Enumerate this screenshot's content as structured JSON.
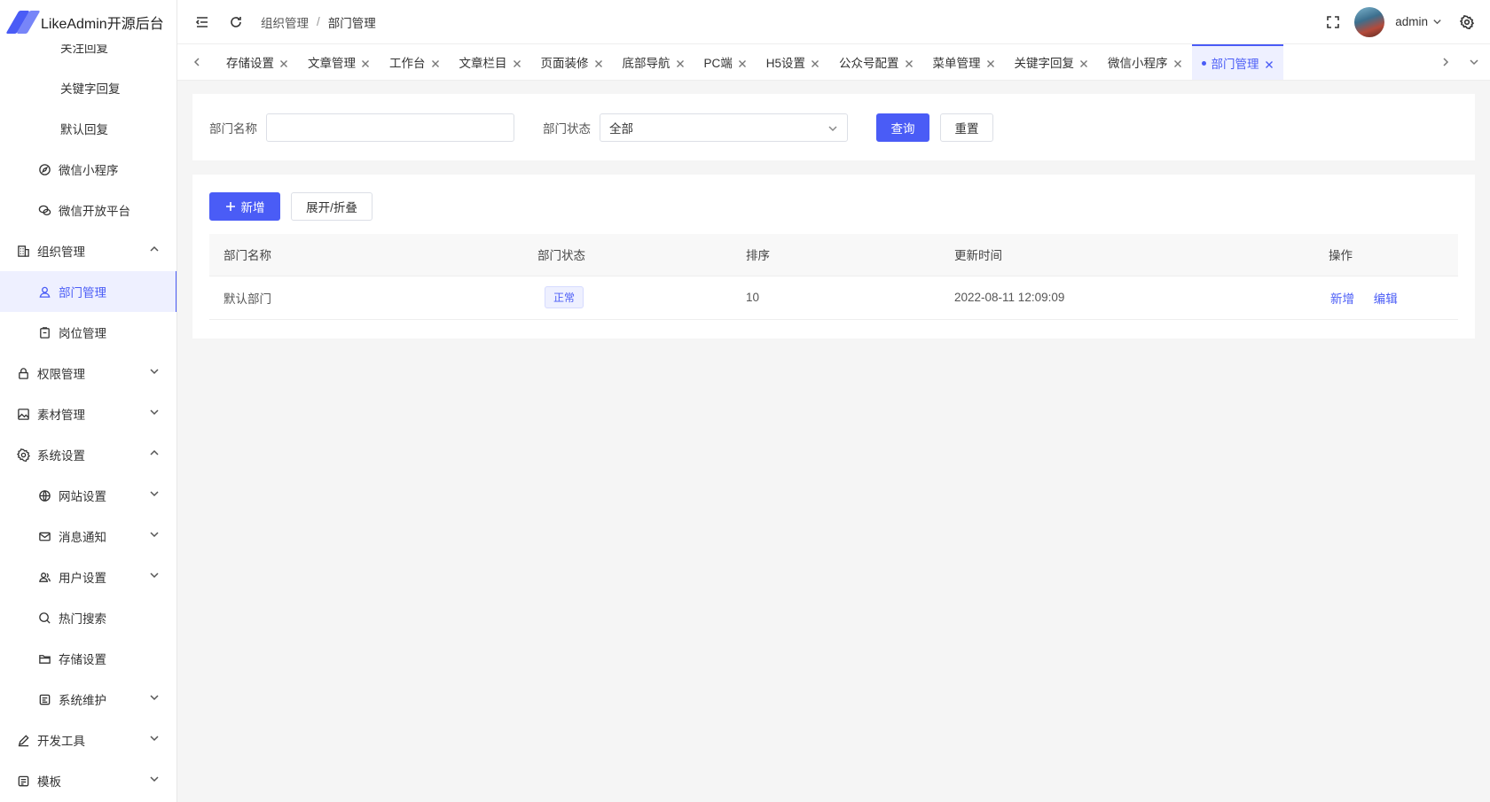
{
  "app": {
    "title": "LikeAdmin开源后台"
  },
  "sidebar": {
    "items": [
      {
        "label": "关注回复",
        "level": 3
      },
      {
        "label": "关键字回复",
        "level": 3
      },
      {
        "label": "默认回复",
        "level": 3
      },
      {
        "label": "微信小程序",
        "level": 2,
        "icon": "compass-icon"
      },
      {
        "label": "微信开放平台",
        "level": 2,
        "icon": "wechat-icon"
      },
      {
        "label": "组织管理",
        "level": 1,
        "icon": "building-icon",
        "arrow": "up"
      },
      {
        "label": "部门管理",
        "level": 2,
        "icon": "user-icon",
        "active": true
      },
      {
        "label": "岗位管理",
        "level": 2,
        "icon": "clipboard-icon"
      },
      {
        "label": "权限管理",
        "level": 1,
        "icon": "lock-icon",
        "arrow": "down"
      },
      {
        "label": "素材管理",
        "level": 1,
        "icon": "picture-icon",
        "arrow": "down"
      },
      {
        "label": "系统设置",
        "level": 1,
        "icon": "gear-icon",
        "arrow": "up"
      },
      {
        "label": "网站设置",
        "level": 2,
        "icon": "globe-icon",
        "arrow": "down"
      },
      {
        "label": "消息通知",
        "level": 2,
        "icon": "mail-icon",
        "arrow": "down"
      },
      {
        "label": "用户设置",
        "level": 2,
        "icon": "users-icon",
        "arrow": "down"
      },
      {
        "label": "热门搜索",
        "level": 2,
        "icon": "search-icon"
      },
      {
        "label": "存储设置",
        "level": 2,
        "icon": "folder-icon"
      },
      {
        "label": "系统维护",
        "level": 2,
        "icon": "maintenance-icon",
        "arrow": "down"
      },
      {
        "label": "开发工具",
        "level": 1,
        "icon": "pen-icon",
        "arrow": "down"
      },
      {
        "label": "模板",
        "level": 1,
        "icon": "template-icon",
        "arrow": "down"
      }
    ]
  },
  "header": {
    "breadcrumb": [
      "组织管理",
      "部门管理"
    ],
    "breadcrumb_sep": "/",
    "user": "admin"
  },
  "tabs": [
    {
      "label": "存储设置"
    },
    {
      "label": "文章管理"
    },
    {
      "label": "工作台"
    },
    {
      "label": "文章栏目"
    },
    {
      "label": "页面装修"
    },
    {
      "label": "底部导航"
    },
    {
      "label": "PC端"
    },
    {
      "label": "H5设置"
    },
    {
      "label": "公众号配置"
    },
    {
      "label": "菜单管理"
    },
    {
      "label": "关键字回复"
    },
    {
      "label": "微信小程序"
    },
    {
      "label": "部门管理",
      "active": true
    }
  ],
  "filter": {
    "name_label": "部门名称",
    "name_value": "",
    "status_label": "部门状态",
    "status_value": "全部",
    "query_label": "查询",
    "reset_label": "重置"
  },
  "toolbar": {
    "add_label": "新增",
    "toggle_label": "展开/折叠"
  },
  "table": {
    "columns": [
      "部门名称",
      "部门状态",
      "排序",
      "更新时间",
      "操作"
    ],
    "rows": [
      {
        "name": "默认部门",
        "status": "正常",
        "sort": "10",
        "updated": "2022-08-11 12:09:09",
        "actions": [
          "新增",
          "编辑"
        ]
      }
    ]
  },
  "colors": {
    "accent": "#4a5cf6"
  }
}
